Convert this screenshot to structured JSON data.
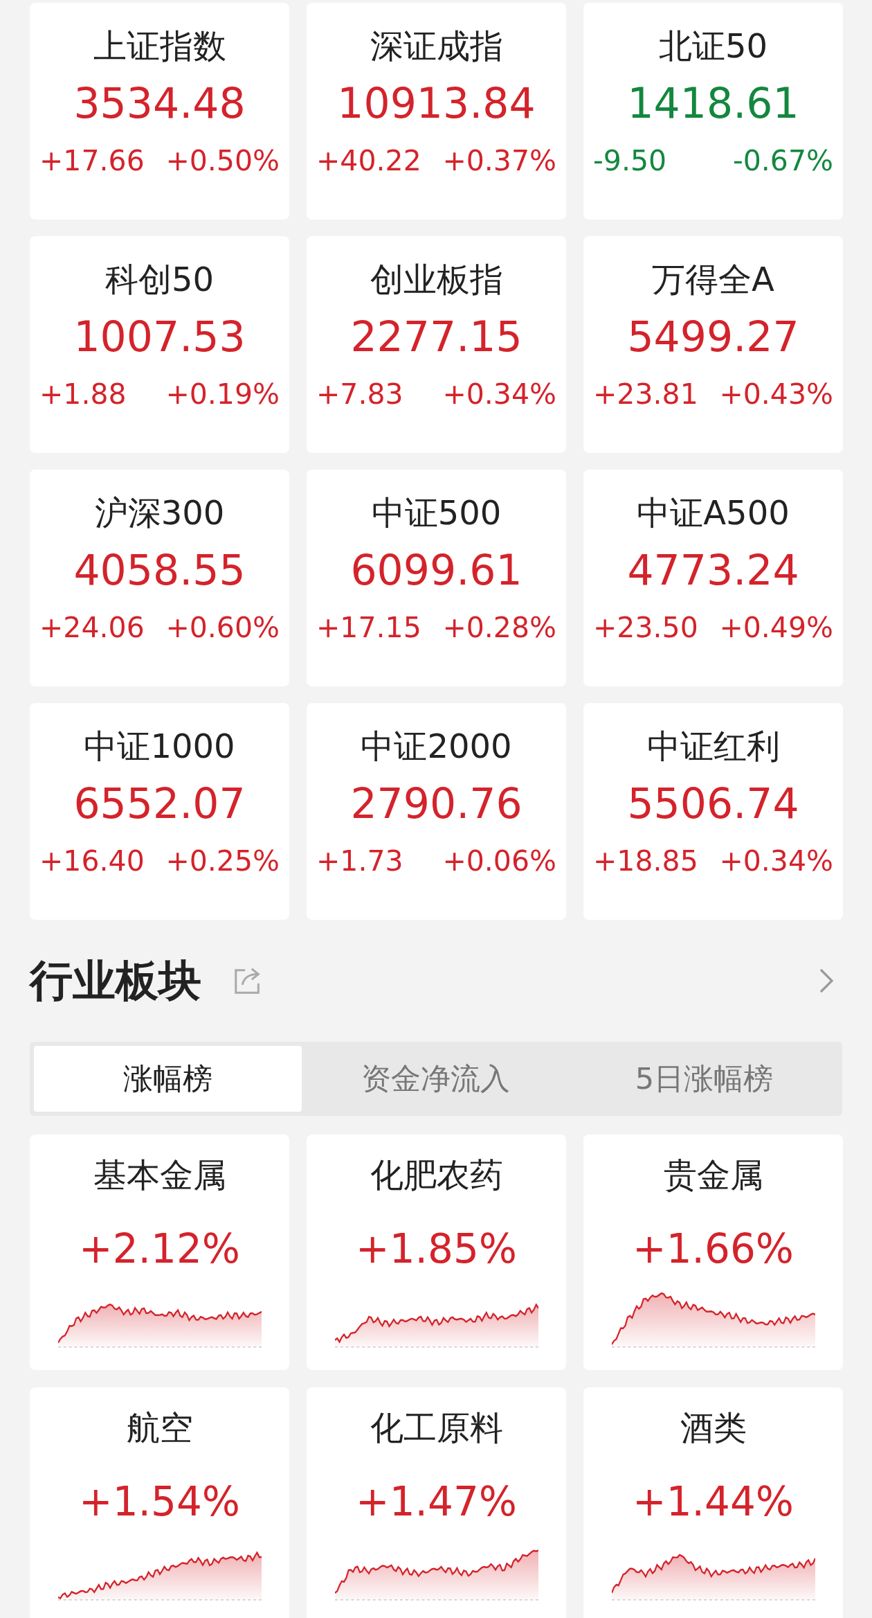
{
  "indices": [
    {
      "name": "上证指数",
      "value": "3534.48",
      "change": "+17.66",
      "percent": "+0.50%",
      "rising": true
    },
    {
      "name": "深证成指",
      "value": "10913.84",
      "change": "+40.22",
      "percent": "+0.37%",
      "rising": true
    },
    {
      "name": "北证50",
      "value": "1418.61",
      "change": "-9.50",
      "percent": "-0.67%",
      "rising": false
    },
    {
      "name": "科创50",
      "value": "1007.53",
      "change": "+1.88",
      "percent": "+0.19%",
      "rising": true
    },
    {
      "name": "创业板指",
      "value": "2277.15",
      "change": "+7.83",
      "percent": "+0.34%",
      "rising": true
    },
    {
      "name": "万得全A",
      "value": "5499.27",
      "change": "+23.81",
      "percent": "+0.43%",
      "rising": true
    },
    {
      "name": "沪深300",
      "value": "4058.55",
      "change": "+24.06",
      "percent": "+0.60%",
      "rising": true
    },
    {
      "name": "中证500",
      "value": "6099.61",
      "change": "+17.15",
      "percent": "+0.28%",
      "rising": true
    },
    {
      "name": "中证A500",
      "value": "4773.24",
      "change": "+23.50",
      "percent": "+0.49%",
      "rising": true
    },
    {
      "name": "中证1000",
      "value": "6552.07",
      "change": "+16.40",
      "percent": "+0.25%",
      "rising": true
    },
    {
      "name": "中证2000",
      "value": "2790.76",
      "change": "+1.73",
      "percent": "+0.06%",
      "rising": true
    },
    {
      "name": "中证红利",
      "value": "5506.74",
      "change": "+18.85",
      "percent": "+0.34%",
      "rising": true
    }
  ],
  "sector_section": {
    "title": "行业板块",
    "tabs": [
      {
        "label": "涨幅榜",
        "selected": true
      },
      {
        "label": "资金净流入",
        "selected": false
      },
      {
        "label": "5日涨幅榜",
        "selected": false
      }
    ],
    "sectors": [
      {
        "name": "基本金属",
        "percent": "+2.12%",
        "rising": true
      },
      {
        "name": "化肥农药",
        "percent": "+1.85%",
        "rising": true
      },
      {
        "name": "贵金属",
        "percent": "+1.66%",
        "rising": true
      },
      {
        "name": "航空",
        "percent": "+1.54%",
        "rising": true
      },
      {
        "name": "化工原料",
        "percent": "+1.47%",
        "rising": true
      },
      {
        "name": "酒类",
        "percent": "+1.44%",
        "rising": true
      }
    ]
  }
}
